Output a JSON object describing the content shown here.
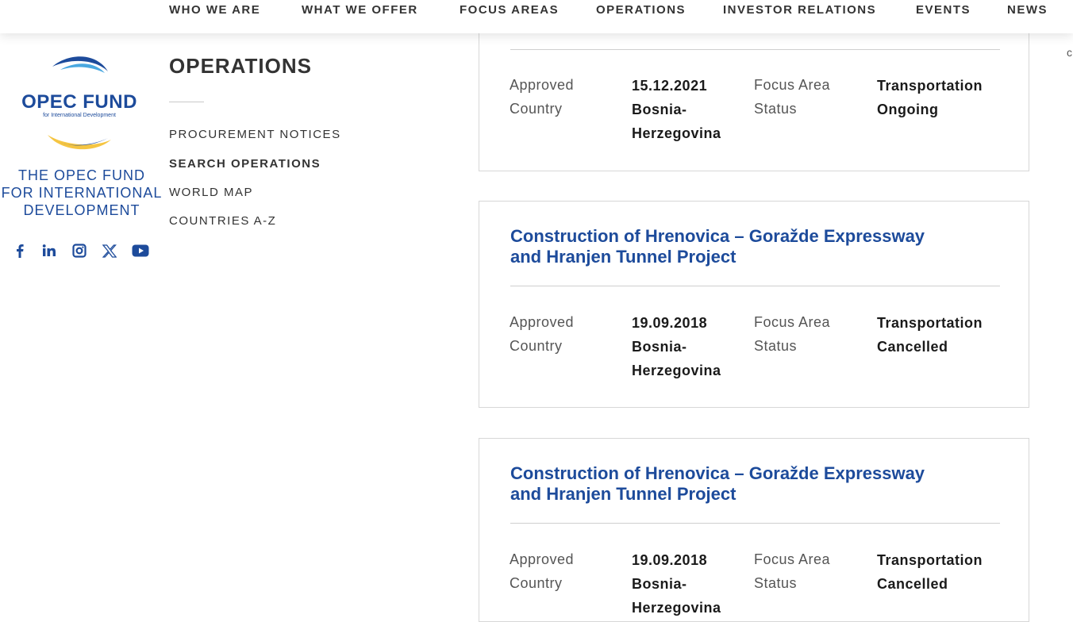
{
  "nav": {
    "items": [
      "WHO WE ARE",
      "WHAT WE OFFER",
      "FOCUS AREAS",
      "OPERATIONS",
      "INVESTOR RELATIONS",
      "EVENTS",
      "NEWS"
    ]
  },
  "edge_char": "c",
  "brand": {
    "logo_title": "OPEC FUND",
    "logo_subtitle": "for International Development",
    "name": "THE OPEC FUND\nFOR INTERNATIONAL\nDEVELOPMENT",
    "social": [
      "facebook-icon",
      "linkedin-icon",
      "instagram-icon",
      "x-icon",
      "youtube-icon"
    ],
    "color": "#1d4b9b",
    "accent": "#f5c542"
  },
  "section": {
    "title": "OPERATIONS",
    "links": [
      {
        "label": "PROCUREMENT NOTICES",
        "active": false
      },
      {
        "label": "SEARCH OPERATIONS",
        "active": true
      },
      {
        "label": "WORLD MAP",
        "active": false
      },
      {
        "label": "COUNTRIES A-Z",
        "active": false
      }
    ]
  },
  "labels": {
    "approved": "Approved",
    "country": "Country",
    "focus_area": "Focus Area",
    "status": "Status"
  },
  "operations": [
    {
      "title": "",
      "approved": "15.12.2021",
      "country": "Bosnia-\nHerzegovina",
      "focus_area": "Transportation",
      "status": "Ongoing"
    },
    {
      "title": "Construction of Hrenovica – Goražde Expressway and Hranjen Tunnel Project",
      "approved": "19.09.2018",
      "country": "Bosnia-\nHerzegovina",
      "focus_area": "Transportation",
      "status": "Cancelled"
    },
    {
      "title": "Construction of Hrenovica – Goražde Expressway and Hranjen Tunnel Project",
      "approved": "19.09.2018",
      "country": "Bosnia-\nHerzegovina",
      "focus_area": "Transportation",
      "status": "Cancelled"
    }
  ]
}
